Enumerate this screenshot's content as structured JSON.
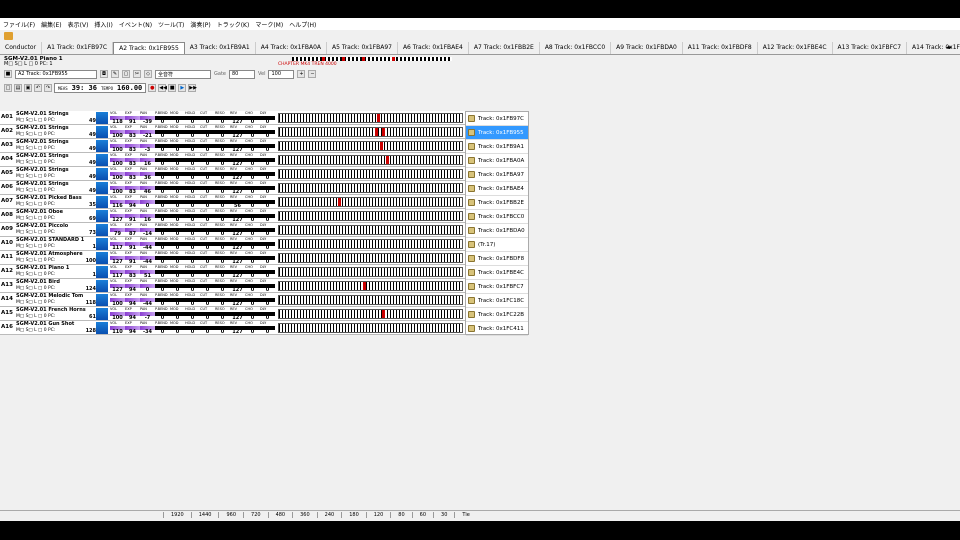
{
  "menu": [
    "ファイル(F)",
    "編集(E)",
    "表示(V)",
    "挿入(I)",
    "イベント(N)",
    "ツール(T)",
    "演奏(P)",
    "トラック(K)",
    "マーク(M)",
    "ヘルプ(H)"
  ],
  "tabs": [
    "Conductor",
    "A1 Track: 0x1FB97C",
    "A2 Track: 0x1FB955",
    "A3 Track: 0x1FB9A1",
    "A4 Track: 0x1FBA0A",
    "A5 Track: 0x1FBA97",
    "A6 Track: 0x1FBAE4",
    "A7 Track: 0x1FBB2E",
    "A8 Track: 0x1FBCC0",
    "A9 Track: 0x1FBDA0",
    "A11 Track: 0x1FBDF8",
    "A12 Track: 0x1FBE4C",
    "A13 Track: 0x1FBFC7",
    "A14 Track: 0x1FC18C",
    "A15 Track: 0x1FC2"
  ],
  "active_tab": 2,
  "header": {
    "piano_name": "SGM-V2.01 Piano 1",
    "piano_sub": "M□ S□ L □ 0 PC: 1",
    "track_combo": "A2 Track: 0x1FB955",
    "all_select": "全音符",
    "gate_label": "Gate",
    "gate_value": "80",
    "vel_label": "Vel",
    "vel_value": "100",
    "meas_label": "MEAS",
    "position": "39: 36",
    "tempo_label": "TEMPO",
    "tempo": "160.00",
    "info_text": "CHAPTER MK4 TREN 4000"
  },
  "param_labels": [
    "VOL",
    "EXP",
    "PAN",
    "P.BEND",
    "MOD",
    "HOLD",
    "CUT",
    "RESO",
    "REV",
    "CHO",
    "DLY"
  ],
  "tracks": [
    {
      "id": "A01",
      "name": "SGM-V2.01 Strings",
      "pc": "49",
      "vals": [
        "118",
        "91",
        "-39",
        "0",
        "0",
        "0",
        "0",
        "0",
        "127",
        "0",
        "0"
      ],
      "marks": [
        98
      ]
    },
    {
      "id": "A02",
      "name": "SGM-V2.01 Strings",
      "pc": "49",
      "vals": [
        "100",
        "83",
        "-21",
        "0",
        "0",
        "0",
        "0",
        "0",
        "127",
        "0",
        "0"
      ],
      "marks": [
        96,
        103
      ]
    },
    {
      "id": "A03",
      "name": "SGM-V2.01 Strings",
      "pc": "49",
      "vals": [
        "100",
        "83",
        "-3",
        "0",
        "0",
        "0",
        "0",
        "0",
        "127",
        "0",
        "0"
      ],
      "marks": [
        101
      ]
    },
    {
      "id": "A04",
      "name": "SGM-V2.01 Strings",
      "pc": "49",
      "vals": [
        "100",
        "83",
        "16",
        "0",
        "0",
        "0",
        "0",
        "0",
        "127",
        "0",
        "0"
      ],
      "marks": [
        107
      ]
    },
    {
      "id": "A05",
      "name": "SGM-V2.01 Strings",
      "pc": "49",
      "vals": [
        "100",
        "83",
        "36",
        "0",
        "0",
        "0",
        "0",
        "0",
        "127",
        "0",
        "0"
      ],
      "marks": []
    },
    {
      "id": "A06",
      "name": "SGM-V2.01 Strings",
      "pc": "49",
      "vals": [
        "100",
        "83",
        "46",
        "0",
        "0",
        "0",
        "0",
        "0",
        "127",
        "0",
        "0"
      ],
      "marks": []
    },
    {
      "id": "A07",
      "name": "SGM-V2.01 Picked Bass",
      "pc": "35",
      "vals": [
        "116",
        "94",
        "0",
        "0",
        "0",
        "0",
        "0",
        "0",
        "56",
        "0",
        "0"
      ],
      "marks": [
        59
      ]
    },
    {
      "id": "A08",
      "name": "SGM-V2.01 Oboe",
      "pc": "69",
      "vals": [
        "127",
        "91",
        "16",
        "0",
        "0",
        "0",
        "0",
        "0",
        "127",
        "0",
        "0"
      ],
      "marks": []
    },
    {
      "id": "A09",
      "name": "SGM-V2.01 Piccolo",
      "pc": "73",
      "vals": [
        "79",
        "87",
        "-14",
        "0",
        "0",
        "0",
        "0",
        "0",
        "127",
        "0",
        "0"
      ],
      "marks": []
    },
    {
      "id": "A10",
      "name": "SGM-V2.01 STANDARD 1",
      "pc": "1",
      "vals": [
        "117",
        "91",
        "-44",
        "0",
        "0",
        "0",
        "0",
        "0",
        "127",
        "0",
        "0"
      ],
      "marks": []
    },
    {
      "id": "A11",
      "name": "SGM-V2.01 Atmosphere",
      "pc": "100",
      "vals": [
        "127",
        "91",
        "-44",
        "0",
        "0",
        "0",
        "0",
        "0",
        "127",
        "0",
        "0"
      ],
      "marks": []
    },
    {
      "id": "A12",
      "name": "SGM-V2.01 Piano 1",
      "pc": "1",
      "vals": [
        "117",
        "83",
        "51",
        "0",
        "0",
        "0",
        "0",
        "0",
        "127",
        "0",
        "0"
      ],
      "marks": []
    },
    {
      "id": "A13",
      "name": "SGM-V2.01 Bird",
      "pc": "124",
      "vals": [
        "127",
        "94",
        "0",
        "0",
        "0",
        "0",
        "0",
        "0",
        "127",
        "0",
        "0"
      ],
      "marks": [
        84
      ]
    },
    {
      "id": "A14",
      "name": "SGM-V2.01 Melodic Tom",
      "pc": "118",
      "vals": [
        "100",
        "94",
        "-44",
        "0",
        "0",
        "0",
        "0",
        "0",
        "127",
        "0",
        "0"
      ],
      "marks": []
    },
    {
      "id": "A15",
      "name": "SGM-V2.01 French Horns",
      "pc": "61",
      "vals": [
        "100",
        "94",
        "-7",
        "0",
        "0",
        "0",
        "0",
        "0",
        "127",
        "0",
        "0"
      ],
      "marks": [
        103
      ]
    },
    {
      "id": "A16",
      "name": "SGM-V2.01 Gun Shot",
      "pc": "128",
      "vals": [
        "110",
        "94",
        "-34",
        "0",
        "0",
        "0",
        "0",
        "0",
        "127",
        "0",
        "0"
      ],
      "marks": []
    }
  ],
  "track_list": [
    "Track: 0x1FB97C",
    "Track: 0x1FB955",
    "Track: 0x1FB9A1",
    "Track: 0x1FBA0A",
    "Track: 0x1FBA97",
    "Track: 0x1FBAE4",
    "Track: 0x1FBB2E",
    "Track: 0x1FBCC0",
    "Track: 0x1FBDA0",
    "(Tr.17)",
    "Track: 0x1FBDF8",
    "Track: 0x1FBE4C",
    "Track: 0x1FBFC7",
    "Track: 0x1FC18C",
    "Track: 0x1FC22B",
    "Track: 0x1FC411"
  ],
  "track_list_selected": 1,
  "status": [
    "1920",
    "1440",
    "960",
    "720",
    "480",
    "360",
    "240",
    "180",
    "120",
    "80",
    "60",
    "30",
    "Tie"
  ]
}
